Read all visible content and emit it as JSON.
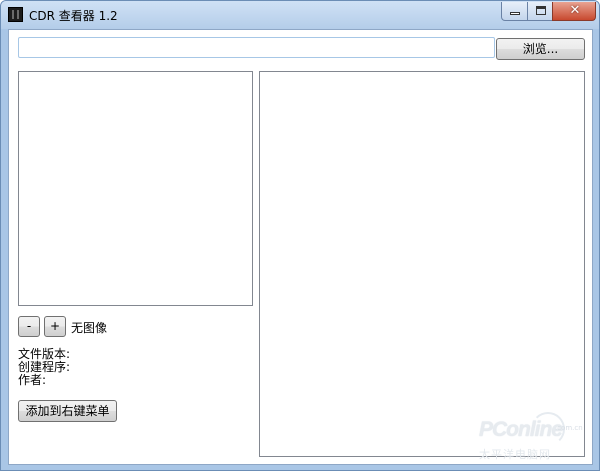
{
  "window": {
    "title": "CDR 查看器 1.2",
    "close_glyph": "✕"
  },
  "toolbar": {
    "path_value": "",
    "browse_label": "浏览..."
  },
  "preview": {
    "zoom_out_label": "-",
    "zoom_in_label": "+",
    "status_text": "无图像"
  },
  "info": {
    "file_version_label": "文件版本:",
    "creator_label": "创建程序:",
    "author_label": "作者:"
  },
  "actions": {
    "add_context_menu_label": "添加到右键菜单"
  },
  "watermark": {
    "brand": "PConline",
    "domain": ".com.cn",
    "sub": "太平洋电脑网"
  },
  "colors": {
    "titlebar": "#b4cde9",
    "close_button": "#c8492f",
    "input_border": "#a7c7e6"
  },
  "icons": [
    "app-icon",
    "minimize-icon",
    "maximize-icon",
    "close-icon"
  ]
}
